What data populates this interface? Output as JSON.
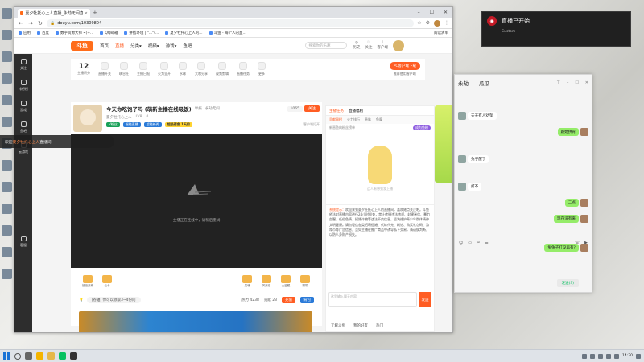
{
  "browser": {
    "tab_title": "夏夕牡托心上人直播_永劫无间直播...",
    "url": "douyu.com/10309804",
    "bookmarks": [
      "应用",
      "百度",
      "数字资源大师・(+...",
      "QQ邮箱",
      "拼搭环境 | \"...\"(...",
      "夏夕牡托心上人的...",
      "斗鱼 - 每个人的直..."
    ],
    "bookmarks_right": "阅读清单"
  },
  "site": {
    "logo": "斗鱼",
    "nav": [
      "首页",
      "直播",
      "分类▾",
      "视频▾",
      "游戏▾",
      "鱼吧"
    ],
    "nav_active": 1,
    "search_placeholder": "搜索你的乐趣",
    "user_icons": [
      "历史",
      "关注",
      "客户端"
    ],
    "left_rail": [
      "关注",
      "排行榜",
      "游戏",
      "鱼吧",
      "云游戏",
      "客服"
    ],
    "strip_count": "12",
    "strip_count_label": "主播积分",
    "strip_items": [
      "直播开关",
      "峡谷旺",
      "主播日报",
      "火力全开",
      "水球",
      "大咖分享",
      "视频剪辑",
      "直播任务",
      "更多"
    ],
    "pc_button": "PC客户端下载",
    "pc_sub": "推荐使用客户端"
  },
  "room": {
    "title": "今天你吃饱了吗  (萌新主播在线吸饭)",
    "report": "举报",
    "game": "永劫无间",
    "anchor": "夏夕牡托心上人",
    "level": "LV8",
    "hot": "0",
    "follow_count": "1065",
    "follow_label": "关注",
    "badge1": "V粉丝",
    "badge2": "福能直播",
    "badge3": "超能新秀",
    "badge4": "超级荷鱼 1天前",
    "share": "客户端打开",
    "player_msg": "主播正在连线中，请稍后重试",
    "gifts": [
      "超级开荒",
      "云卡",
      "灵魂",
      "风景在",
      "大鲨鲲",
      "飘带"
    ],
    "task_label": "[卷轴] 你可以领取3~4份问",
    "hot_text": "热力 4238",
    "fans_text": "贡献 23",
    "pay": "充值",
    "pack": "背包"
  },
  "chat": {
    "tabs": [
      "主播任务",
      "直播福利"
    ],
    "rank_tabs": [
      "贡献周榜",
      "火力排行",
      "贵族",
      "鱼摩"
    ],
    "tip": "新晋鱼的粉丝榜单",
    "tip_go": "成为鱼粉",
    "illus_caption": "这人有想到我上播",
    "notice_tag": "系统提示：",
    "notice": "欢迎来到夏夕牡托心上人的直播间，喜欢她点关注吧。斗鱼依法对直播内容进行24小时巡查，禁止传播违法违规、封建迷信、暴力血腥、低俗色情、招嫖诈骗等违法不良信息，坚决维护青少年群体精神文明健康。请勿轻信各类招聘征婚、代练代充、刷钻、购买礼包码、游戏币等广告信息，且如主播在推广商品中诱导私下交易，请谨慎判断，以防人身财产损失。",
    "input_placeholder": "这里输入聊天内容",
    "send": "发送",
    "friends": [
      "了解斗鱼",
      "我的好友",
      "热门"
    ]
  },
  "toast": {
    "prefix": "欢迎",
    "highlight": "夏夕牡托心上人",
    "suffix": "直播间"
  },
  "notification": {
    "title": "直播已开始",
    "sub": "Custom"
  },
  "qq": {
    "title": "永劫——瓜瓜",
    "messages": [
      {
        "side": "l",
        "text": "天天有人劝架"
      },
      {
        "side": "r",
        "text": "跟她拼肯"
      },
      {
        "side": "l",
        "text": "兔子醒了"
      },
      {
        "side": "l",
        "text": "打不"
      },
      {
        "side": "r",
        "text": "二点"
      },
      {
        "side": "r",
        "text": "现在没有来"
      },
      {
        "side": "r",
        "text": "兔兔子打没再有?"
      }
    ],
    "send": "发送(S)"
  },
  "taskbar": {
    "time": "14:30"
  },
  "colors": {
    "accent": "#ff5d23",
    "wechat_green": "#95ec69",
    "notif_red": "#c31a26"
  }
}
